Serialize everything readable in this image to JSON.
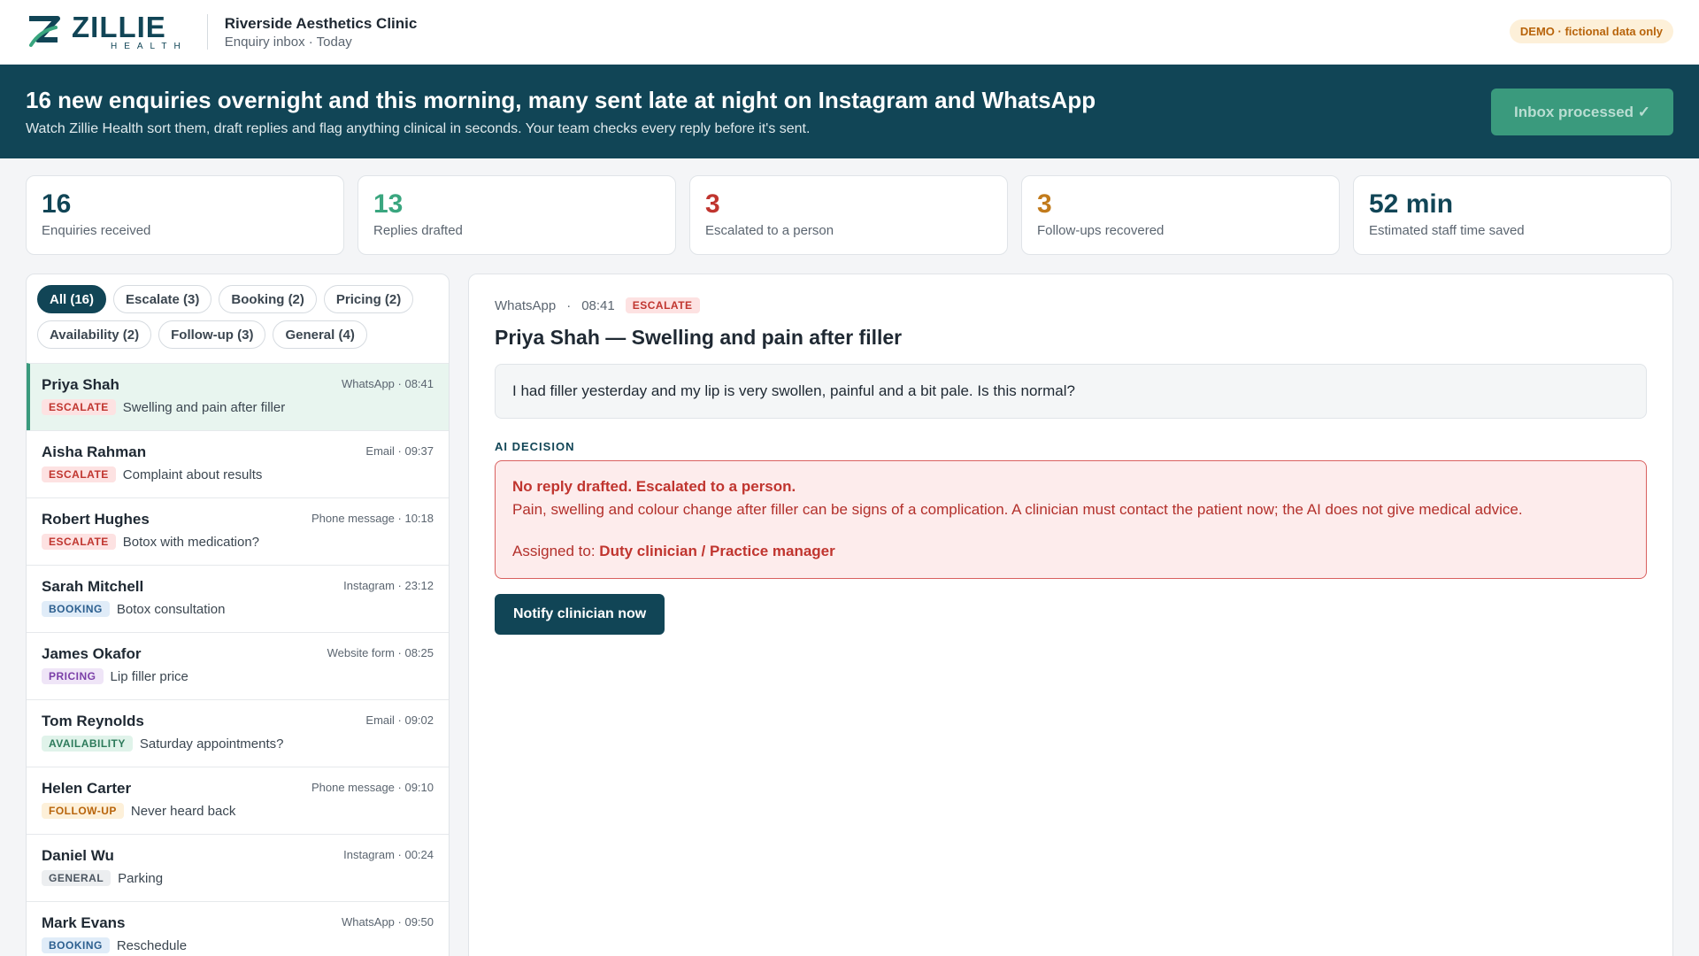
{
  "header": {
    "logo_word": "ZILLIE",
    "logo_sub": "HEALTH",
    "clinic_name": "Riverside Aesthetics Clinic",
    "clinic_sub": "Enquiry inbox · Today",
    "demo_label": "DEMO · fictional data only"
  },
  "banner": {
    "title": "16 new enquiries overnight and this morning, many sent late at night on Instagram and WhatsApp",
    "subtitle": "Watch Zillie Health sort them, draft replies and flag anything clinical in seconds. Your team checks every reply before it's sent.",
    "button_label": "Inbox processed ✓"
  },
  "stats": [
    {
      "value": "16",
      "label": "Enquiries received",
      "color": "#114556"
    },
    {
      "value": "13",
      "label": "Replies drafted",
      "color": "#3aa67f"
    },
    {
      "value": "3",
      "label": "Escalated to a person",
      "color": "#c0352f"
    },
    {
      "value": "3",
      "label": "Follow-ups recovered",
      "color": "#c27b1c"
    },
    {
      "value": "52 min",
      "label": "Estimated staff time saved",
      "color": "#114556"
    }
  ],
  "filters": [
    {
      "label": "All (16)",
      "active": true
    },
    {
      "label": "Escalate (3)",
      "active": false
    },
    {
      "label": "Booking (2)",
      "active": false
    },
    {
      "label": "Pricing (2)",
      "active": false
    },
    {
      "label": "Availability (2)",
      "active": false
    },
    {
      "label": "Follow-up (3)",
      "active": false
    },
    {
      "label": "General (4)",
      "active": false
    }
  ],
  "tag_styles": {
    "ESCALATE": {
      "bg": "#fde2e2",
      "fg": "#c0352f"
    },
    "BOOKING": {
      "bg": "#e0ecf8",
      "fg": "#2c5f8f"
    },
    "PRICING": {
      "bg": "#efe5f7",
      "fg": "#7b3fa8"
    },
    "AVAILABILITY": {
      "bg": "#e0f3ea",
      "fg": "#2c7a5a"
    },
    "FOLLOW-UP": {
      "bg": "#fdf0d9",
      "fg": "#b8640b"
    },
    "GENERAL": {
      "bg": "#eceef0",
      "fg": "#4b5560"
    }
  },
  "enquiries": [
    {
      "name": "Priya Shah",
      "meta": "WhatsApp · 08:41",
      "tag": "ESCALATE",
      "subject": "Swelling and pain after filler",
      "selected": true
    },
    {
      "name": "Aisha Rahman",
      "meta": "Email · 09:37",
      "tag": "ESCALATE",
      "subject": "Complaint about results",
      "selected": false
    },
    {
      "name": "Robert Hughes",
      "meta": "Phone message · 10:18",
      "tag": "ESCALATE",
      "subject": "Botox with medication?",
      "selected": false
    },
    {
      "name": "Sarah Mitchell",
      "meta": "Instagram · 23:12",
      "tag": "BOOKING",
      "subject": "Botox consultation",
      "selected": false
    },
    {
      "name": "James Okafor",
      "meta": "Website form · 08:25",
      "tag": "PRICING",
      "subject": "Lip filler price",
      "selected": false
    },
    {
      "name": "Tom Reynolds",
      "meta": "Email · 09:02",
      "tag": "AVAILABILITY",
      "subject": "Saturday appointments?",
      "selected": false
    },
    {
      "name": "Helen Carter",
      "meta": "Phone message · 09:10",
      "tag": "FOLLOW-UP",
      "subject": "Never heard back",
      "selected": false
    },
    {
      "name": "Daniel Wu",
      "meta": "Instagram · 00:24",
      "tag": "GENERAL",
      "subject": "Parking",
      "selected": false
    },
    {
      "name": "Mark Evans",
      "meta": "WhatsApp · 09:50",
      "tag": "BOOKING",
      "subject": "Reschedule",
      "selected": false
    }
  ],
  "detail": {
    "channel": "WhatsApp",
    "separator": "·",
    "time": "08:41",
    "tag": "ESCALATE",
    "title": "Priya Shah — Swelling and pain after filler",
    "message": "I had filler yesterday and my lip is very swollen, painful and a bit pale. Is this normal?",
    "decision_label": "AI DECISION",
    "decision_head": "No reply drafted. Escalated to a person.",
    "decision_body": "Pain, swelling and colour change after filler can be signs of a complication. A clinician must contact the patient now; the AI does not give medical advice.",
    "assigned_label": "Assigned to:",
    "assigned_value": "Duty clinician / Practice manager",
    "action_label": "Notify clinician now"
  }
}
